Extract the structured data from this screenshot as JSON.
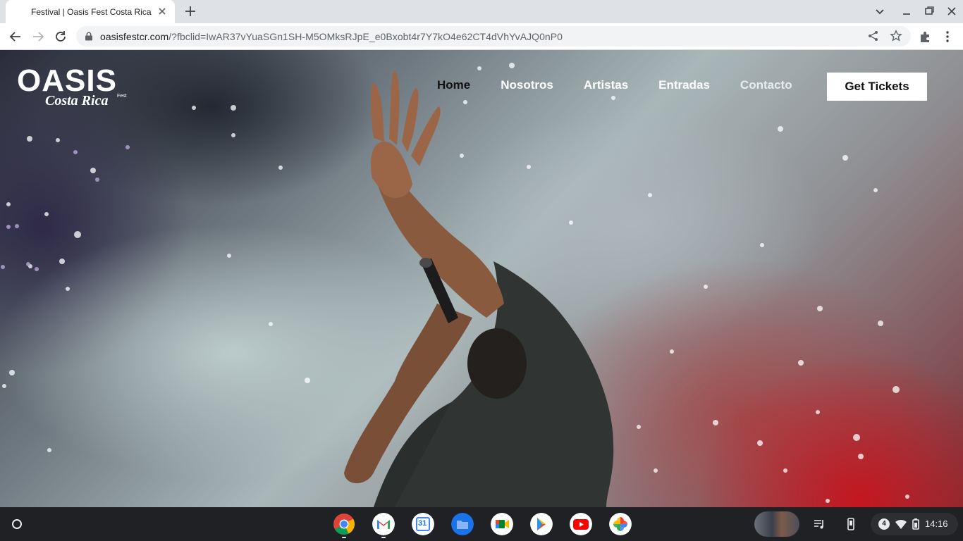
{
  "browser": {
    "tab_title": "Festival | Oasis Fest Costa Rica",
    "url_host": "oasisfestcr.com",
    "url_rest": "/?fbclid=IwAR37vYuaSGn1SH-M5OMksRJpE_e0Bxobt4r7Y7kO4e62CT4dVhYvAJQ0nP0"
  },
  "site": {
    "logo_main": "OASIS",
    "logo_sub": "Costa Rica",
    "logo_fest": "Fest",
    "nav": {
      "home": "Home",
      "nosotros": "Nosotros",
      "artistas": "Artistas",
      "entradas": "Entradas",
      "contacto": "Contacto"
    },
    "cta": "Get Tickets"
  },
  "shelf": {
    "apps": [
      "chrome-icon",
      "gmail-icon",
      "calendar-icon",
      "files-icon",
      "meet-icon",
      "play-store-icon",
      "youtube-icon",
      "photos-icon"
    ],
    "calendar_day": "31",
    "notifications": "4",
    "time": "14:16"
  },
  "colors": {
    "tabstrip": "#dee1e6",
    "omnibox": "#f1f3f4",
    "shelf": "#202124",
    "cta_bg": "#ffffff"
  }
}
